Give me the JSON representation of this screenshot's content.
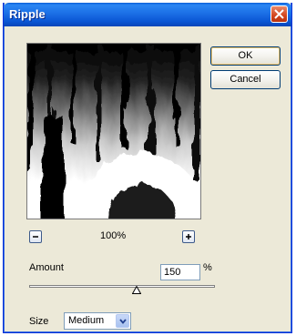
{
  "window": {
    "title": "Ripple"
  },
  "buttons": {
    "ok": "OK",
    "cancel": "Cancel"
  },
  "preview": {
    "zoom": "100%",
    "zoom_out_icon": "minus-icon",
    "zoom_in_icon": "plus-icon"
  },
  "controls": {
    "amount_label": "Amount",
    "amount_value": "150",
    "amount_unit": "%",
    "size_label": "Size",
    "size_value": "Medium"
  },
  "colors": {
    "titlebar": "#1b6fe6",
    "dialog_bg": "#ece9d8",
    "close": "#d2451d"
  }
}
